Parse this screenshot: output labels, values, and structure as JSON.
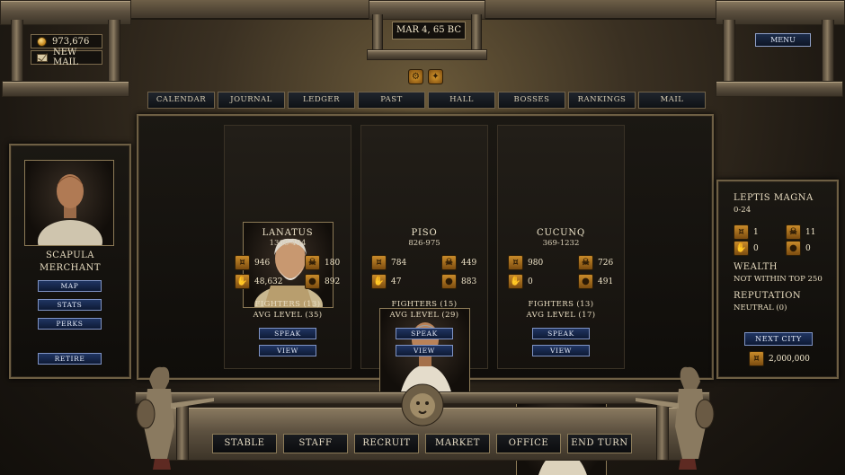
{
  "header": {
    "gold": "973,676",
    "new_mail": "NEW MAIL",
    "date": "MAR 4, 65 BC",
    "menu": "MENU"
  },
  "tabs": [
    "CALENDAR",
    "JOURNAL",
    "LEDGER",
    "PAST",
    "HALL",
    "BOSSES",
    "RANKINGS",
    "MAIL"
  ],
  "player": {
    "name": "SCAPULA",
    "role": "MERCHANT",
    "buttons": {
      "map": "MAP",
      "stats": "STATS",
      "perks": "PERKS",
      "retire": "RETIRE"
    }
  },
  "bosses": [
    {
      "name": "LANATUS",
      "range": "1306-494",
      "stats": [
        "946",
        "180",
        "48,632",
        "892"
      ],
      "fighters": "FIGHTERS (13)",
      "avg_level": "AVG LEVEL (35)",
      "speak": "SPEAK",
      "view": "VIEW"
    },
    {
      "name": "PISO",
      "range": "826-975",
      "stats": [
        "784",
        "449",
        "47",
        "883"
      ],
      "fighters": "FIGHTERS (15)",
      "avg_level": "AVG LEVEL (29)",
      "speak": "SPEAK",
      "view": "VIEW"
    },
    {
      "name": "CUCUNQ",
      "range": "369-1232",
      "stats": [
        "980",
        "726",
        "0",
        "491"
      ],
      "fighters": "FIGHTERS (13)",
      "avg_level": "AVG LEVEL (17)",
      "speak": "SPEAK",
      "view": "VIEW"
    }
  ],
  "city": {
    "name": "LEPTIS MAGNA",
    "record": "0-24",
    "stats": [
      "1",
      "11",
      "0",
      "0"
    ],
    "wealth_label": "WEALTH",
    "wealth_value": "NOT WITHIN TOP 250",
    "reputation_label": "REPUTATION",
    "reputation_value": "NEUTRAL (0)",
    "next_city": "NEXT CITY",
    "cost": "2,000,000"
  },
  "bottom": [
    "STABLE",
    "STAFF",
    "RECRUIT",
    "MARKET",
    "OFFICE",
    "END TURN"
  ],
  "colors": {
    "accent_gold": "#c98b2a",
    "button_blue": "#203562",
    "frame_stone": "#8a7a60"
  }
}
